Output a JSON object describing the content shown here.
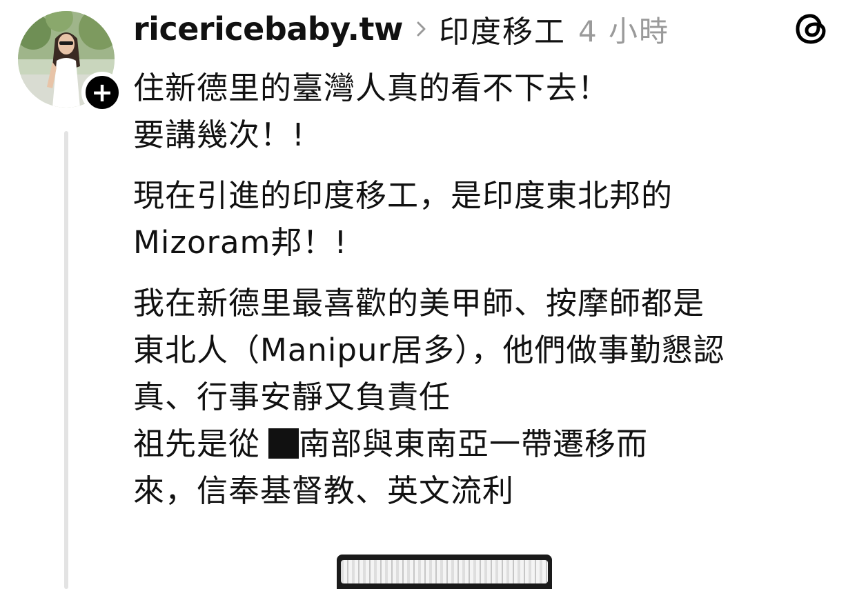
{
  "post": {
    "username": "ricericebaby.tw",
    "topic": "印度移工",
    "timestamp": "4 小時",
    "lines": [
      "住新德里的臺灣人真的看不下去！",
      "要講幾次！!",
      "現在引進的印度移工，是印度東北邦的",
      "Mizoram邦！!",
      "我在新德里最喜歡的美甲師、按摩師都是",
      "東北人（Manipur居多），他們做事勤懇認",
      "真、行事安靜又負責任",
      "祖先是從",
      "南部與東南亞一帶遷移而",
      "來，信奉基督教、英文流利"
    ]
  },
  "icons": {
    "app_logo": "threads-icon",
    "follow": "plus-icon",
    "chevron": "chevron-right-icon"
  },
  "colors": {
    "text": "#111111",
    "muted": "#9a9a9a",
    "thread_line": "#e3e3e3",
    "background": "#ffffff"
  }
}
